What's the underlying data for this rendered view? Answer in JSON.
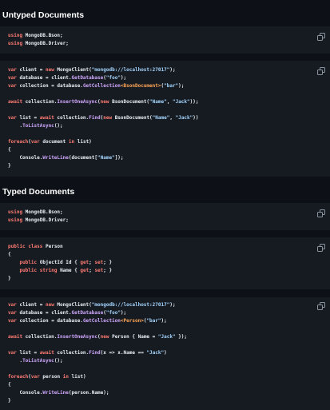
{
  "sections": [
    {
      "title": "Untyped Documents",
      "blocks": [
        {
          "lines": [
            [
              {
                "t": "using",
                "c": "kw"
              },
              {
                "t": " MongoDB.Bson;",
                "c": "txt"
              }
            ],
            [
              {
                "t": "using",
                "c": "kw"
              },
              {
                "t": " MongoDB.Driver;",
                "c": "txt"
              }
            ]
          ]
        },
        {
          "lines": [
            [
              {
                "t": "var",
                "c": "kw"
              },
              {
                "t": " client = ",
                "c": "txt"
              },
              {
                "t": "new",
                "c": "kw"
              },
              {
                "t": " MongoClient(",
                "c": "txt"
              },
              {
                "t": "\"mongodb://localhost:27017\"",
                "c": "str"
              },
              {
                "t": ");",
                "c": "txt"
              }
            ],
            [
              {
                "t": "var",
                "c": "kw"
              },
              {
                "t": " database = client.",
                "c": "txt"
              },
              {
                "t": "GetDatabase",
                "c": "fn"
              },
              {
                "t": "(",
                "c": "txt"
              },
              {
                "t": "\"foo\"",
                "c": "str"
              },
              {
                "t": ");",
                "c": "txt"
              }
            ],
            [
              {
                "t": "var",
                "c": "kw"
              },
              {
                "t": " collection = database.",
                "c": "txt"
              },
              {
                "t": "GetCollection",
                "c": "fn"
              },
              {
                "t": "<BsonDocument>",
                "c": "ty"
              },
              {
                "t": "(",
                "c": "txt"
              },
              {
                "t": "\"bar\"",
                "c": "str"
              },
              {
                "t": ");",
                "c": "txt"
              }
            ],
            [],
            [
              {
                "t": "await",
                "c": "kw"
              },
              {
                "t": " collection.",
                "c": "txt"
              },
              {
                "t": "InsertOneAsync",
                "c": "fn"
              },
              {
                "t": "(",
                "c": "txt"
              },
              {
                "t": "new",
                "c": "kw"
              },
              {
                "t": " BsonDocument(",
                "c": "txt"
              },
              {
                "t": "\"Name\"",
                "c": "str"
              },
              {
                "t": ", ",
                "c": "txt"
              },
              {
                "t": "\"Jack\"",
                "c": "str"
              },
              {
                "t": "));",
                "c": "txt"
              }
            ],
            [],
            [
              {
                "t": "var",
                "c": "kw"
              },
              {
                "t": " list = ",
                "c": "txt"
              },
              {
                "t": "await",
                "c": "kw"
              },
              {
                "t": " collection.",
                "c": "txt"
              },
              {
                "t": "Find",
                "c": "fn"
              },
              {
                "t": "(",
                "c": "txt"
              },
              {
                "t": "new",
                "c": "kw"
              },
              {
                "t": " BsonDocument(",
                "c": "txt"
              },
              {
                "t": "\"Name\"",
                "c": "str"
              },
              {
                "t": ", ",
                "c": "txt"
              },
              {
                "t": "\"Jack\"",
                "c": "str"
              },
              {
                "t": "))",
                "c": "txt"
              }
            ],
            [
              {
                "t": "    .",
                "c": "txt"
              },
              {
                "t": "ToListAsync",
                "c": "fn"
              },
              {
                "t": "();",
                "c": "txt"
              }
            ],
            [],
            [
              {
                "t": "foreach",
                "c": "kw"
              },
              {
                "t": "(",
                "c": "txt"
              },
              {
                "t": "var",
                "c": "kw"
              },
              {
                "t": " document ",
                "c": "txt"
              },
              {
                "t": "in",
                "c": "kw"
              },
              {
                "t": " list)",
                "c": "txt"
              }
            ],
            [
              {
                "t": "{",
                "c": "txt"
              }
            ],
            [
              {
                "t": "    Console.",
                "c": "txt"
              },
              {
                "t": "WriteLine",
                "c": "fn"
              },
              {
                "t": "(document[",
                "c": "txt"
              },
              {
                "t": "\"Name\"",
                "c": "str"
              },
              {
                "t": "]);",
                "c": "txt"
              }
            ],
            [
              {
                "t": "}",
                "c": "txt"
              }
            ]
          ]
        }
      ]
    },
    {
      "title": "Typed Documents",
      "blocks": [
        {
          "lines": [
            [
              {
                "t": "using",
                "c": "kw"
              },
              {
                "t": " MongoDB.Bson;",
                "c": "txt"
              }
            ],
            [
              {
                "t": "using",
                "c": "kw"
              },
              {
                "t": " MongoDB.Driver;",
                "c": "txt"
              }
            ]
          ]
        },
        {
          "lines": [
            [
              {
                "t": "public",
                "c": "kw"
              },
              {
                "t": " ",
                "c": "txt"
              },
              {
                "t": "class",
                "c": "kw"
              },
              {
                "t": " Person",
                "c": "txt"
              }
            ],
            [
              {
                "t": "{",
                "c": "txt"
              }
            ],
            [
              {
                "t": "    ",
                "c": "txt"
              },
              {
                "t": "public",
                "c": "kw"
              },
              {
                "t": " ObjectId Id { ",
                "c": "txt"
              },
              {
                "t": "get",
                "c": "kw"
              },
              {
                "t": "; ",
                "c": "txt"
              },
              {
                "t": "set",
                "c": "kw"
              },
              {
                "t": "; }",
                "c": "txt"
              }
            ],
            [
              {
                "t": "    ",
                "c": "txt"
              },
              {
                "t": "public",
                "c": "kw"
              },
              {
                "t": " ",
                "c": "txt"
              },
              {
                "t": "string",
                "c": "kw"
              },
              {
                "t": " Name { ",
                "c": "txt"
              },
              {
                "t": "get",
                "c": "kw"
              },
              {
                "t": "; ",
                "c": "txt"
              },
              {
                "t": "set",
                "c": "kw"
              },
              {
                "t": "; }",
                "c": "txt"
              }
            ],
            [
              {
                "t": "}",
                "c": "txt"
              }
            ]
          ]
        },
        {
          "lines": [
            [
              {
                "t": "var",
                "c": "kw"
              },
              {
                "t": " client = ",
                "c": "txt"
              },
              {
                "t": "new",
                "c": "kw"
              },
              {
                "t": " MongoClient(",
                "c": "txt"
              },
              {
                "t": "\"mongodb://localhost:27017\"",
                "c": "str"
              },
              {
                "t": ");",
                "c": "txt"
              }
            ],
            [
              {
                "t": "var",
                "c": "kw"
              },
              {
                "t": " database = client.",
                "c": "txt"
              },
              {
                "t": "GetDatabase",
                "c": "fn"
              },
              {
                "t": "(",
                "c": "txt"
              },
              {
                "t": "\"foo\"",
                "c": "str"
              },
              {
                "t": ");",
                "c": "txt"
              }
            ],
            [
              {
                "t": "var",
                "c": "kw"
              },
              {
                "t": " collection = database.",
                "c": "txt"
              },
              {
                "t": "GetCollection",
                "c": "fn"
              },
              {
                "t": "<Person>",
                "c": "ty"
              },
              {
                "t": "(",
                "c": "txt"
              },
              {
                "t": "\"bar\"",
                "c": "str"
              },
              {
                "t": ");",
                "c": "txt"
              }
            ],
            [],
            [
              {
                "t": "await",
                "c": "kw"
              },
              {
                "t": " collection.",
                "c": "txt"
              },
              {
                "t": "InsertOneAsync",
                "c": "fn"
              },
              {
                "t": "(",
                "c": "txt"
              },
              {
                "t": "new",
                "c": "kw"
              },
              {
                "t": " Person { Name = ",
                "c": "txt"
              },
              {
                "t": "\"Jack\"",
                "c": "str"
              },
              {
                "t": " });",
                "c": "txt"
              }
            ],
            [],
            [
              {
                "t": "var",
                "c": "kw"
              },
              {
                "t": " list = ",
                "c": "txt"
              },
              {
                "t": "await",
                "c": "kw"
              },
              {
                "t": " collection.",
                "c": "txt"
              },
              {
                "t": "Find",
                "c": "fn"
              },
              {
                "t": "(x => x.Name == ",
                "c": "txt"
              },
              {
                "t": "\"Jack\"",
                "c": "str"
              },
              {
                "t": ")",
                "c": "txt"
              }
            ],
            [
              {
                "t": "    .",
                "c": "txt"
              },
              {
                "t": "ToListAsync",
                "c": "fn"
              },
              {
                "t": "();",
                "c": "txt"
              }
            ],
            [],
            [
              {
                "t": "foreach",
                "c": "kw"
              },
              {
                "t": "(",
                "c": "txt"
              },
              {
                "t": "var",
                "c": "kw"
              },
              {
                "t": " person ",
                "c": "txt"
              },
              {
                "t": "in",
                "c": "kw"
              },
              {
                "t": " list)",
                "c": "txt"
              }
            ],
            [
              {
                "t": "{",
                "c": "txt"
              }
            ],
            [
              {
                "t": "    Console.",
                "c": "txt"
              },
              {
                "t": "WriteLine",
                "c": "fn"
              },
              {
                "t": "(person.Name);",
                "c": "txt"
              }
            ],
            [
              {
                "t": "}",
                "c": "txt"
              }
            ]
          ]
        }
      ]
    }
  ],
  "copy_icon": "copy-icon",
  "colors": {
    "page_bg": "#0d1117",
    "block_bg": "#161b22",
    "keyword": "#ff7b72",
    "string": "#a5d6ff",
    "method": "#d2a8ff",
    "type": "#ffa657",
    "text": "#e6edf3"
  }
}
